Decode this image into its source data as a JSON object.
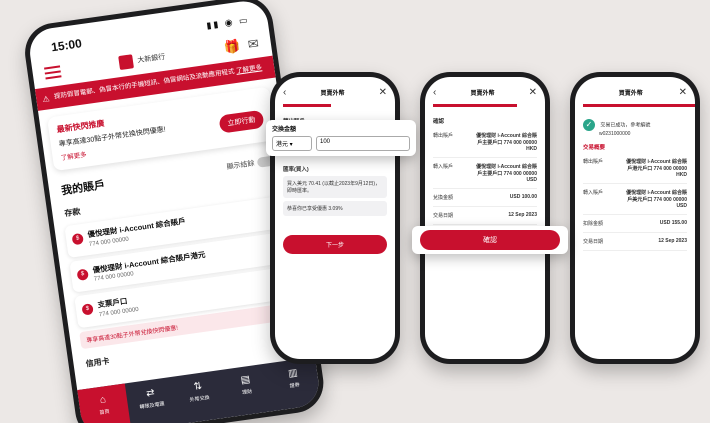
{
  "phone1": {
    "status_time": "15:00",
    "logo_text": "大新銀行",
    "notice_text": "提防假冒電郵、偽冒本行的手機短訊、偽冒網站及流動應用程式",
    "notice_more": "了解更多",
    "promo": {
      "title": "最新快閃推廣",
      "text": "專享高達30點子外幣兌換快閃優惠!",
      "link": "了解更多",
      "button": "立即行動"
    },
    "accounts_title": "我的賬戶",
    "show_balance": "顯示結餘",
    "savings_title": "存款",
    "accounts": [
      {
        "name": "優悅理財 i-Account 綜合賬戶",
        "num": "774 000 00000"
      },
      {
        "name": "優悅理財 i-Account 綜合賬戶港元",
        "num": "774 000 00000"
      },
      {
        "name": "支票戶口",
        "num": "774 000 00000"
      }
    ],
    "promo_row": "專享高達30點子外幣兌換快閃優惠!",
    "credit_title": "信用卡",
    "tabs": [
      "首頁",
      "轉賬及電匯",
      "外幣兌換",
      "理財",
      "證券"
    ]
  },
  "phone2": {
    "title": "買賣外幣",
    "section": "轉出賬戶",
    "amount_label": "交換金額",
    "currency": "港元",
    "amount": "100",
    "rate_label": "匯率(買入)",
    "note": "買入美元 70.41 (以截止2023年9月12日)，即時匯率。",
    "promo": "恭喜你已享受優惠 3.09%",
    "button": "下一步"
  },
  "phone3": {
    "title": "買賣外幣",
    "section": "確認",
    "rows": [
      {
        "k": "轉出賬戶",
        "v": "優悅理財 i-Account 綜合賬戶主要戶口 774 000 00000 HKD"
      },
      {
        "k": "轉入賬戶",
        "v": "優悅理財 i-Account 綜合賬戶主要戶口 774 000 00000 USD"
      },
      {
        "k": "兌換金額",
        "v": "USD 100.00"
      },
      {
        "k": "交易日期",
        "v": "12 Sep 2023"
      }
    ],
    "button": "確認"
  },
  "phone4": {
    "title": "買賣外幣",
    "success": "交易已成功，參考編號",
    "ref": "w0231000000",
    "section": "交易概要",
    "rows": [
      {
        "k": "轉出賬戶",
        "v": "優悅理財 i-Account 綜合賬戶港元戶口 774 000 00000 HKD"
      },
      {
        "k": "轉入賬戶",
        "v": "優悅理財 i-Account 綜合賬戶美元戶口 774 000 00000 USD"
      },
      {
        "k": "扣除金額",
        "v": "USD 155.00"
      },
      {
        "k": "交易日期",
        "v": "12 Sep 2023"
      }
    ]
  }
}
